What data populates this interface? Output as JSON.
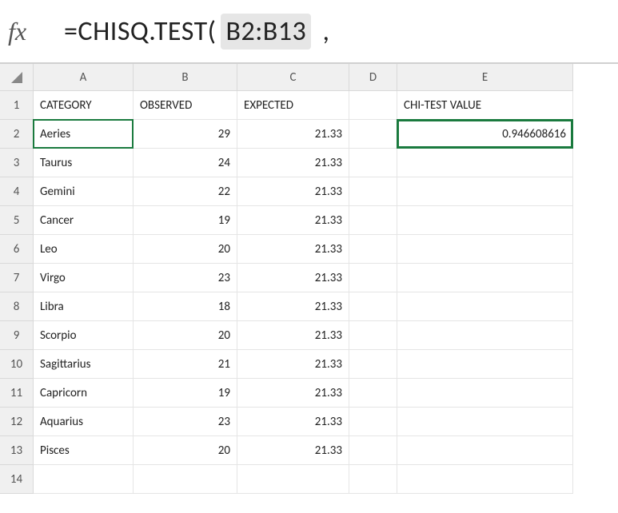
{
  "formula_bar": {
    "fx_label": "fx",
    "prefix": "=CHISQ.TEST(",
    "highlight": "B2:B13",
    "suffix": " ,"
  },
  "columns": [
    "A",
    "B",
    "C",
    "D",
    "E"
  ],
  "row_numbers": [
    "1",
    "2",
    "3",
    "4",
    "5",
    "6",
    "7",
    "8",
    "9",
    "10",
    "11",
    "12",
    "13",
    "14"
  ],
  "headers": {
    "A": "CATEGORY",
    "B": "OBSERVED",
    "C": "EXPECTED",
    "D": "",
    "E": "CHI-TEST VALUE"
  },
  "rows": [
    {
      "A": "Aeries",
      "B": "29",
      "C": "21.33",
      "D": "",
      "E": "0.946608616"
    },
    {
      "A": "Taurus",
      "B": "24",
      "C": "21.33",
      "D": "",
      "E": ""
    },
    {
      "A": "Gemini",
      "B": "22",
      "C": "21.33",
      "D": "",
      "E": ""
    },
    {
      "A": "Cancer",
      "B": "19",
      "C": "21.33",
      "D": "",
      "E": ""
    },
    {
      "A": "Leo",
      "B": "20",
      "C": "21.33",
      "D": "",
      "E": ""
    },
    {
      "A": "Virgo",
      "B": "23",
      "C": "21.33",
      "D": "",
      "E": ""
    },
    {
      "A": "Libra",
      "B": "18",
      "C": "21.33",
      "D": "",
      "E": ""
    },
    {
      "A": "Scorpio",
      "B": "20",
      "C": "21.33",
      "D": "",
      "E": ""
    },
    {
      "A": "Sagittarius",
      "B": "21",
      "C": "21.33",
      "D": "",
      "E": ""
    },
    {
      "A": "Capricorn",
      "B": "19",
      "C": "21.33",
      "D": "",
      "E": ""
    },
    {
      "A": "Aquarius",
      "B": "23",
      "C": "21.33",
      "D": "",
      "E": ""
    },
    {
      "A": "Pisces",
      "B": "20",
      "C": "21.33",
      "D": "",
      "E": ""
    }
  ]
}
